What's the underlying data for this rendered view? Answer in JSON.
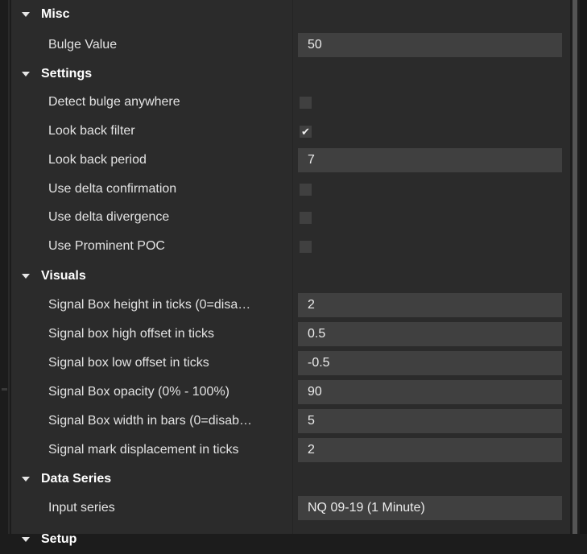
{
  "categories": {
    "misc": "Misc",
    "settings": "Settings",
    "visuals": "Visuals",
    "data_series": "Data Series",
    "setup": "Setup"
  },
  "misc": {
    "bulge_value": {
      "label": "Bulge Value",
      "value": "50"
    }
  },
  "settings": {
    "detect_bulge_anywhere": {
      "label": "Detect bulge anywhere",
      "checked": false
    },
    "look_back_filter": {
      "label": "Look back filter",
      "checked": true,
      "mark": "✔"
    },
    "look_back_period": {
      "label": "Look back period",
      "value": "7"
    },
    "use_delta_confirmation": {
      "label": "Use delta confirmation",
      "checked": false
    },
    "use_delta_divergence": {
      "label": "Use delta divergence",
      "checked": false
    },
    "use_prominent_poc": {
      "label": "Use Prominent POC",
      "checked": false
    }
  },
  "visuals": {
    "signal_box_height": {
      "label": "Signal Box height in ticks (0=disa…",
      "value": "2"
    },
    "signal_box_high_offset": {
      "label": "Signal box high offset in ticks",
      "value": "0.5"
    },
    "signal_box_low_offset": {
      "label": "Signal box low offset in ticks",
      "value": "-0.5"
    },
    "signal_box_opacity": {
      "label": "Signal Box opacity (0% - 100%)",
      "value": "90"
    },
    "signal_box_width": {
      "label": "Signal Box width in bars (0=disab…",
      "value": "5"
    },
    "signal_mark_displacement": {
      "label": "Signal mark displacement in ticks",
      "value": "2"
    }
  },
  "data_series": {
    "input_series": {
      "label": "Input series",
      "value": "NQ 09-19 (1 Minute)"
    }
  },
  "colors": {
    "background": "#2b2b2b",
    "value_cell": "#404040",
    "text": "#e3e3e3",
    "category_text": "#ffffff"
  }
}
